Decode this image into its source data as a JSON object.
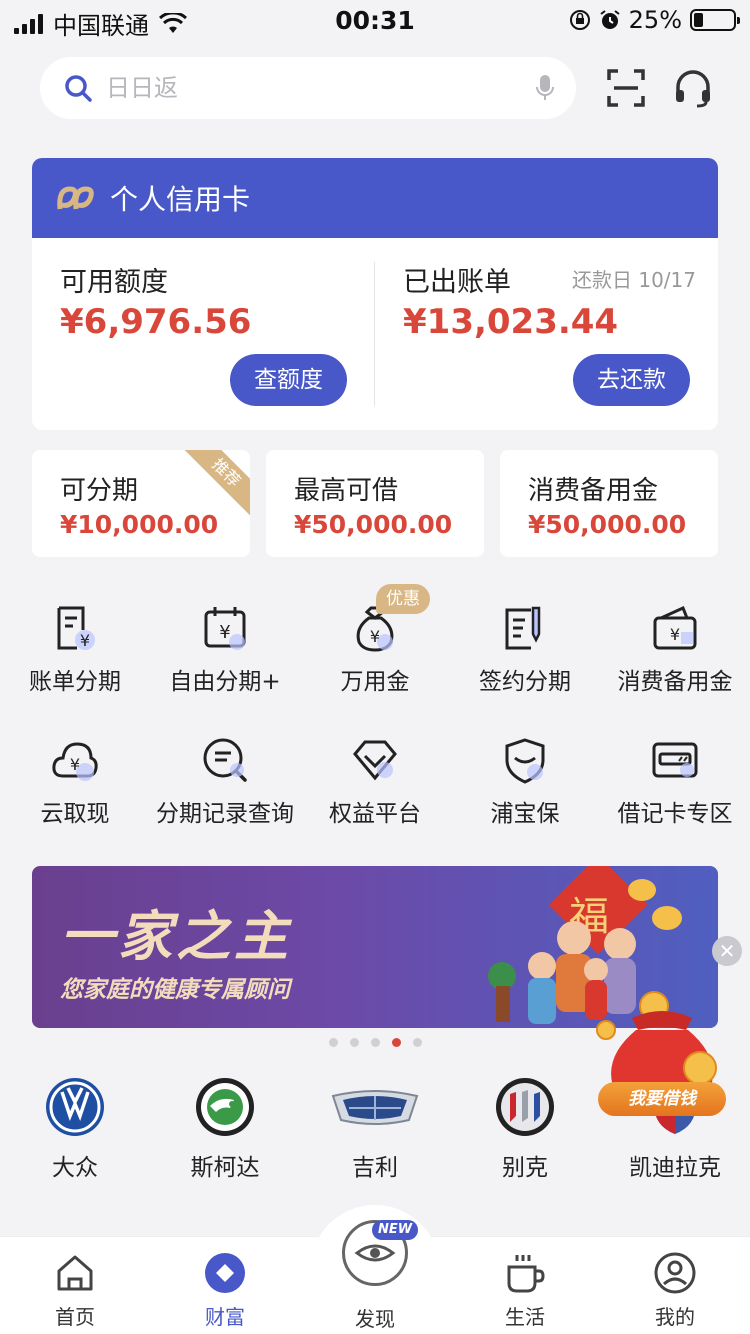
{
  "status_bar": {
    "carrier": "中国联通",
    "time": "00:31",
    "battery": "25%"
  },
  "search": {
    "placeholder": "日日返",
    "value": ""
  },
  "card_panel": {
    "title": "个人信用卡",
    "available": {
      "label": "可用额度",
      "amount": "¥6,976.56",
      "button": "查额度"
    },
    "statement": {
      "label": "已出账单",
      "due_date": "还款日 10/17",
      "amount": "¥13,023.44",
      "button": "去还款"
    }
  },
  "quick_cards": [
    {
      "label": "可分期",
      "amount": "¥10,000.00",
      "ribbon": "推荐"
    },
    {
      "label": "最高可借",
      "amount": "¥50,000.00"
    },
    {
      "label": "消费备用金",
      "amount": "¥50,000.00"
    }
  ],
  "services": [
    {
      "label": "账单分期",
      "icon": "bill-yen-icon"
    },
    {
      "label": "自由分期+",
      "icon": "calendar-yen-icon"
    },
    {
      "label": "万用金",
      "icon": "money-bag-icon",
      "tag": "优惠"
    },
    {
      "label": "签约分期",
      "icon": "contract-pen-icon"
    },
    {
      "label": "消费备用金",
      "icon": "wallet-yen-icon"
    },
    {
      "label": "云取现",
      "icon": "cloud-yen-icon"
    },
    {
      "label": "分期记录查询",
      "icon": "search-record-icon"
    },
    {
      "label": "权益平台",
      "icon": "diamond-check-icon"
    },
    {
      "label": "浦宝保",
      "icon": "shield-icon"
    },
    {
      "label": "借记卡专区",
      "icon": "debit-card-icon"
    }
  ],
  "banner": {
    "headline": "一家之主",
    "subtitle": "您家庭的健康专属顾问",
    "art_character": "福"
  },
  "carousel": {
    "count": 5,
    "active_index": 3
  },
  "brands": [
    {
      "label": "大众",
      "icon": "volkswagen-logo-icon"
    },
    {
      "label": "斯柯达",
      "icon": "skoda-logo-icon"
    },
    {
      "label": "吉利",
      "icon": "geely-logo-icon"
    },
    {
      "label": "别克",
      "icon": "buick-logo-icon"
    },
    {
      "label": "凯迪拉克",
      "icon": "cadillac-logo-icon"
    }
  ],
  "floating_promo": {
    "label": "我要借钱"
  },
  "tabs": [
    {
      "label": "首页",
      "icon": "home-icon"
    },
    {
      "label": "财富",
      "icon": "wealth-diamond-icon",
      "active": true
    },
    {
      "label": "发现",
      "icon": "discover-eye-icon",
      "badge": "NEW"
    },
    {
      "label": "生活",
      "icon": "coffee-cup-icon"
    },
    {
      "label": "我的",
      "icon": "profile-icon"
    }
  ],
  "colors": {
    "primary": "#4858c8",
    "amount_red": "#d9473a",
    "gold": "#d8b784",
    "background": "#f3f3f5"
  }
}
